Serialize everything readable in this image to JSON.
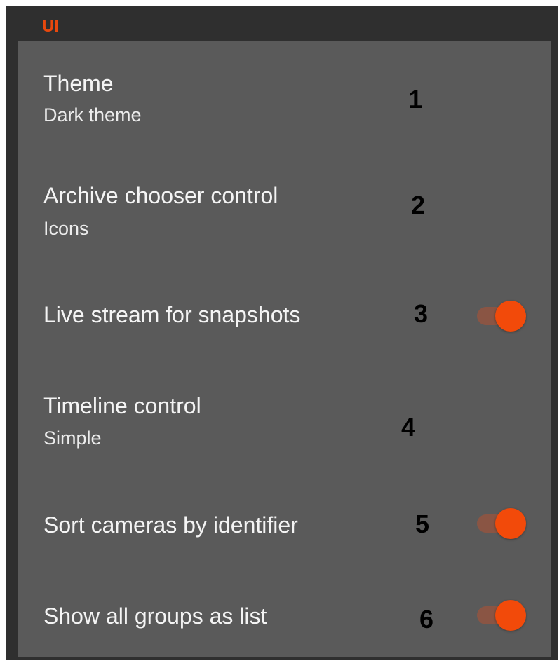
{
  "section": {
    "title": "UI"
  },
  "colors": {
    "accent": "#e8480d",
    "panel_background": "#5a5a5a",
    "frame_background": "#2f2f2f",
    "toggle_on": "#f24a0a"
  },
  "settings": [
    {
      "title": "Theme",
      "subtitle": "Dark theme",
      "marker": "1"
    },
    {
      "title": "Archive chooser control",
      "subtitle": "Icons",
      "marker": "2"
    },
    {
      "title": "Live stream for snapshots",
      "marker": "3",
      "toggle": "on"
    },
    {
      "title": "Timeline control",
      "subtitle": "Simple",
      "marker": "4"
    },
    {
      "title": "Sort cameras by identifier",
      "marker": "5",
      "toggle": "on"
    },
    {
      "title": "Show all groups as list",
      "marker": "6",
      "toggle": "on"
    }
  ]
}
